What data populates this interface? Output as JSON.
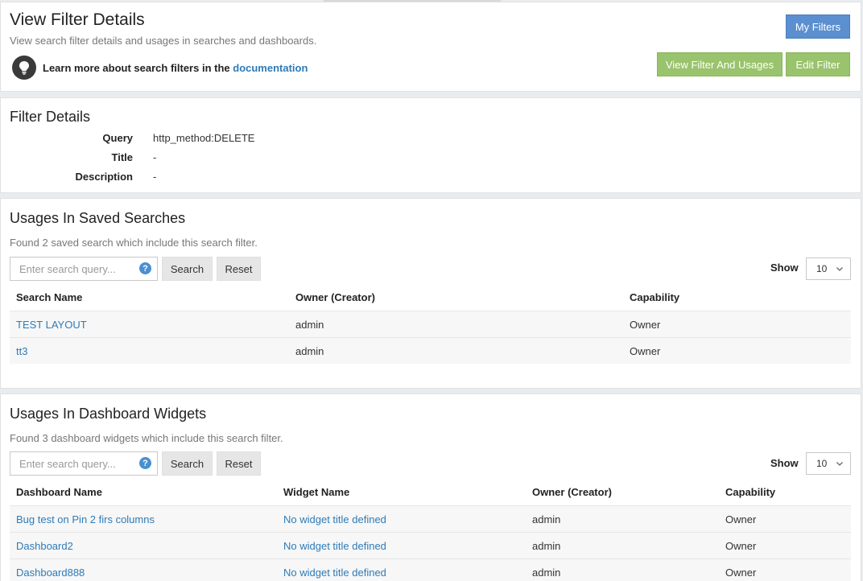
{
  "header": {
    "title": "View Filter Details",
    "subtitle": "View search filter details and usages in searches and dashboards.",
    "learn_prefix": "Learn more about search filters in the ",
    "learn_link": "documentation",
    "buttons": {
      "my_filters": "My Filters",
      "view_usages": "View Filter And Usages",
      "edit_filter": "Edit Filter"
    }
  },
  "filter_details": {
    "title": "Filter Details",
    "rows": [
      {
        "label": "Query",
        "value": "http_method:DELETE"
      },
      {
        "label": "Title",
        "value": "-"
      },
      {
        "label": "Description",
        "value": "-"
      }
    ]
  },
  "saved_searches": {
    "title": "Usages In Saved Searches",
    "subtitle": "Found 2 saved search which include this search filter.",
    "search_placeholder": "Enter search query...",
    "search_label": "Search",
    "reset_label": "Reset",
    "show_label": "Show",
    "show_value": "10",
    "columns": [
      "Search Name",
      "Owner (Creator)",
      "Capability"
    ],
    "rows": [
      {
        "name": "TEST LAYOUT",
        "owner": "admin",
        "capability": "Owner"
      },
      {
        "name": "tt3",
        "owner": "admin",
        "capability": "Owner"
      }
    ]
  },
  "dashboard_widgets": {
    "title": "Usages In Dashboard Widgets",
    "subtitle": "Found 3 dashboard widgets which include this search filter.",
    "search_placeholder": "Enter search query...",
    "search_label": "Search",
    "reset_label": "Reset",
    "show_label": "Show",
    "show_value": "10",
    "columns": [
      "Dashboard Name",
      "Widget Name",
      "Owner (Creator)",
      "Capability"
    ],
    "rows": [
      {
        "dashboard": "Bug test on Pin 2 firs columns",
        "widget": "No widget title defined",
        "owner": "admin",
        "capability": "Owner"
      },
      {
        "dashboard": "Dashboard2",
        "widget": "No widget title defined",
        "owner": "admin",
        "capability": "Owner"
      },
      {
        "dashboard": "Dashboard888",
        "widget": "No widget title defined",
        "owner": "admin",
        "capability": "Owner"
      }
    ]
  }
}
